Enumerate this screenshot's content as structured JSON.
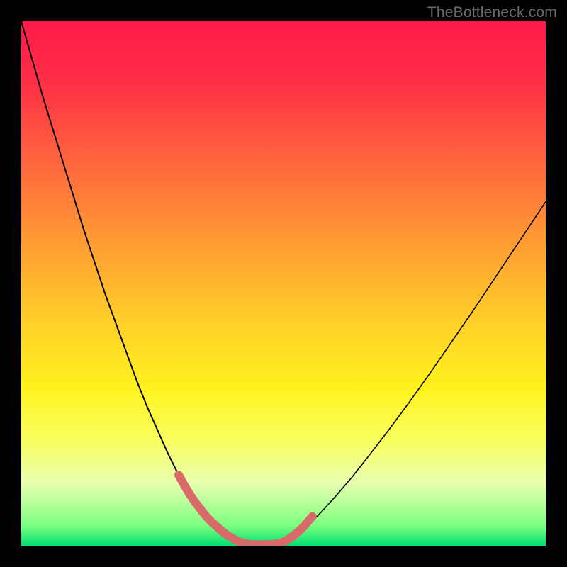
{
  "watermark": "TheBottleneck.com",
  "chart_data": {
    "type": "line",
    "title": "",
    "xlabel": "",
    "ylabel": "",
    "xlim": [
      0,
      100
    ],
    "ylim": [
      0,
      100
    ],
    "gradient_stops": [
      {
        "offset": 0.0,
        "color": "#ff1a4a"
      },
      {
        "offset": 0.12,
        "color": "#ff3046"
      },
      {
        "offset": 0.28,
        "color": "#ff6a3c"
      },
      {
        "offset": 0.44,
        "color": "#ffa232"
      },
      {
        "offset": 0.58,
        "color": "#ffd228"
      },
      {
        "offset": 0.7,
        "color": "#fff21e"
      },
      {
        "offset": 0.8,
        "color": "#f8ff60"
      },
      {
        "offset": 0.88,
        "color": "#e8ffb0"
      },
      {
        "offset": 0.96,
        "color": "#80ff80"
      },
      {
        "offset": 1.0,
        "color": "#00e070"
      }
    ],
    "series": [
      {
        "name": "left-curve",
        "x": [
          0.0,
          2.0,
          4.0,
          6.0,
          8.0,
          10.0,
          12.0,
          14.0,
          16.0,
          18.0,
          20.0,
          22.0,
          24.0,
          26.0,
          28.0,
          30.0,
          31.5,
          33.0,
          34.5,
          36.0,
          37.5,
          39.0,
          40.5,
          42.0
        ],
        "y": [
          100,
          93,
          86,
          79.5,
          73,
          66.5,
          60,
          54,
          48,
          42.5,
          37,
          31.5,
          26.5,
          22,
          17.5,
          13.5,
          11,
          8.5,
          6.5,
          4.8,
          3.4,
          2.2,
          1.2,
          0.6
        ],
        "stroke": "#000000",
        "width": 2.0
      },
      {
        "name": "right-curve",
        "x": [
          50.0,
          51.5,
          53.0,
          55.0,
          57.0,
          60.0,
          63.0,
          66.0,
          70.0,
          74.0,
          78.0,
          82.0,
          86.0,
          90.0,
          94.0,
          98.0,
          100.0
        ],
        "y": [
          0.6,
          1.4,
          2.5,
          4.2,
          6.2,
          9.5,
          13.0,
          16.8,
          22.0,
          27.4,
          33.0,
          38.8,
          44.6,
          50.6,
          56.6,
          62.6,
          65.6
        ],
        "stroke": "#000000",
        "width": 1.6
      },
      {
        "name": "left-highlight",
        "x": [
          30.0,
          31.0,
          32.0,
          33.0,
          34.0,
          35.0,
          36.0,
          37.0,
          38.0,
          39.0,
          40.0,
          41.0,
          42.0
        ],
        "y": [
          13.5,
          11.7,
          10.0,
          8.5,
          7.2,
          5.9,
          4.8,
          3.9,
          3.0,
          2.2,
          1.6,
          1.0,
          0.6
        ],
        "stroke": "#d86a6a",
        "width": 12,
        "linecap": "round"
      },
      {
        "name": "bottom-highlight",
        "x": [
          42.0,
          43.5,
          45.0,
          46.5,
          48.0,
          49.5
        ],
        "y": [
          0.6,
          0.3,
          0.2,
          0.2,
          0.3,
          0.5
        ],
        "stroke": "#d86a6a",
        "width": 12,
        "linecap": "round"
      },
      {
        "name": "right-highlight",
        "x": [
          49.5,
          50.5,
          51.5,
          52.5,
          53.5,
          54.5,
          55.5
        ],
        "y": [
          0.5,
          1.0,
          1.6,
          2.4,
          3.3,
          4.4,
          5.6
        ],
        "stroke": "#d86a6a",
        "width": 12,
        "linecap": "round"
      }
    ]
  }
}
